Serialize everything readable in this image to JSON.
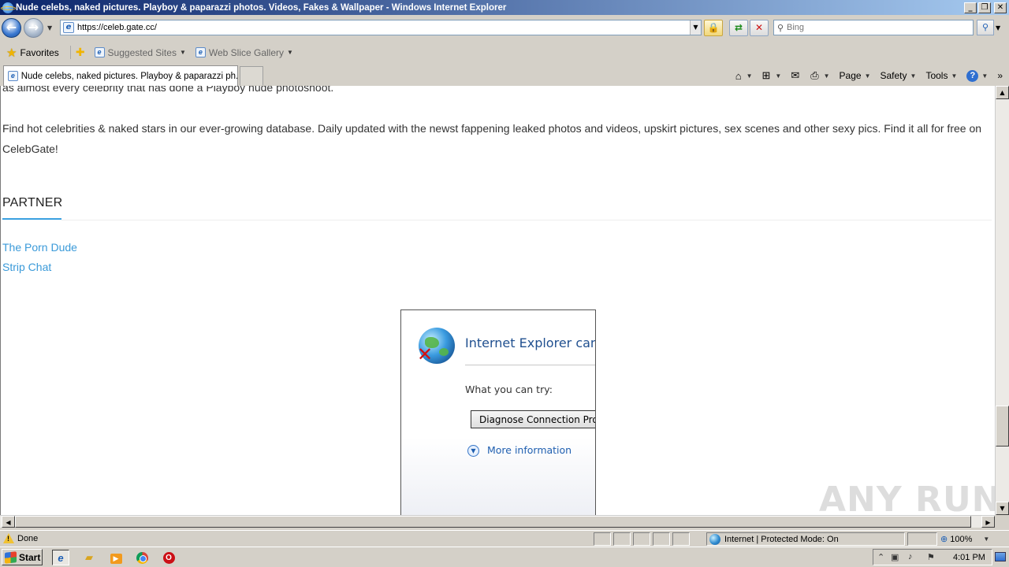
{
  "window": {
    "title": "Nude celebs, naked pictures. Playboy & paparazzi photos. Videos, Fakes & Wallpaper - Windows Internet Explorer",
    "caption_buttons": [
      "minimize",
      "restore",
      "close"
    ]
  },
  "address_bar": {
    "url": "https://celeb.gate.cc/",
    "search_placeholder": "Bing"
  },
  "favorites_bar": {
    "favorites_label": "Favorites",
    "items": [
      {
        "label": "Suggested Sites"
      },
      {
        "label": "Web Slice Gallery"
      }
    ]
  },
  "tabs": [
    {
      "label": "Nude celebs, naked pictures. Playboy & paparazzi ph...",
      "active": true
    }
  ],
  "command_bar": {
    "page_label": "Page",
    "safety_label": "Safety",
    "tools_label": "Tools"
  },
  "content": {
    "para1": "as almost every celebrity that has done a Playboy nude photoshoot.",
    "para2": "Find hot celebrities & naked stars in our ever-growing database. Daily updated with the newst fappening leaked photos and videos, upskirt pictures, sex scenes and other sexy pics. Find it all for free on CelebGate!",
    "partner_heading": "PARTNER",
    "partner_links": [
      "The Porn Dude",
      "Strip Chat"
    ]
  },
  "error_frame": {
    "title": "Internet Explorer cann",
    "try_label": "What you can try:",
    "diagnose_button": "Diagnose Connection Pro",
    "more_info": "More information"
  },
  "watermark": "ANY RUN",
  "status_bar": {
    "status": "Done",
    "zone": "Internet | Protected Mode: On",
    "zoom": "100%"
  },
  "taskbar": {
    "start_label": "Start",
    "clock": "4:01 PM"
  },
  "colors": {
    "link": "#3a9ad9",
    "partner_underline": "#3aa0e0",
    "error_title": "#1f4f8f",
    "titlebar_start": "#0a246a"
  }
}
